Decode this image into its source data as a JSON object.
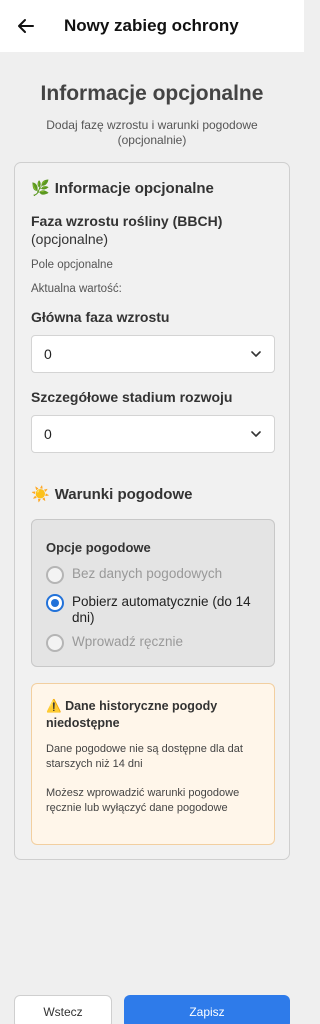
{
  "appbar": {
    "title": "Nowy zabieg ochrony",
    "back_icon": "arrow-left-icon"
  },
  "header": {
    "title": "Informacje opcjonalne",
    "subtitle": "Dodaj fazę wzrostu i warunki pogodowe (opcjonalnie)"
  },
  "card": {
    "optional_section": {
      "emoji": "🌿",
      "title": "Informacje opcjonalne",
      "bbch_label": "Faza wzrostu rośliny (BBCH)",
      "bbch_optional": "(opcjonalne)",
      "optional_field": "Pole opcjonalne",
      "current_value": "Aktualna wartość:",
      "main_phase_label": "Główna faza wzrostu",
      "main_phase_value": "0",
      "detail_stage_label": "Szczegółowe stadium rozwoju",
      "detail_stage_value": "0"
    },
    "weather_section": {
      "emoji": "☀️",
      "title": "Warunki pogodowe",
      "options_title": "Opcje pogodowe",
      "options": [
        {
          "label": "Bez danych pogodowych",
          "selected": false
        },
        {
          "label": "Pobierz automatycznie (do 14 dni)",
          "selected": true
        },
        {
          "label": "Wprowadź ręcznie",
          "selected": false
        }
      ]
    },
    "warning": {
      "icon": "⚠️",
      "title": "Dane historyczne pogody niedostępne",
      "text1": "Dane pogodowe nie są dostępne dla dat starszych niż 14 dni",
      "text2": "Możesz wprowadzić warunki pogodowe ręcznie lub wyłączyć dane pogodowe",
      "accent_color": "#f2cfa0"
    }
  },
  "footer": {
    "back_label": "Wstecz",
    "save_label": "Zapisz",
    "save_color": "#2e7bea"
  }
}
